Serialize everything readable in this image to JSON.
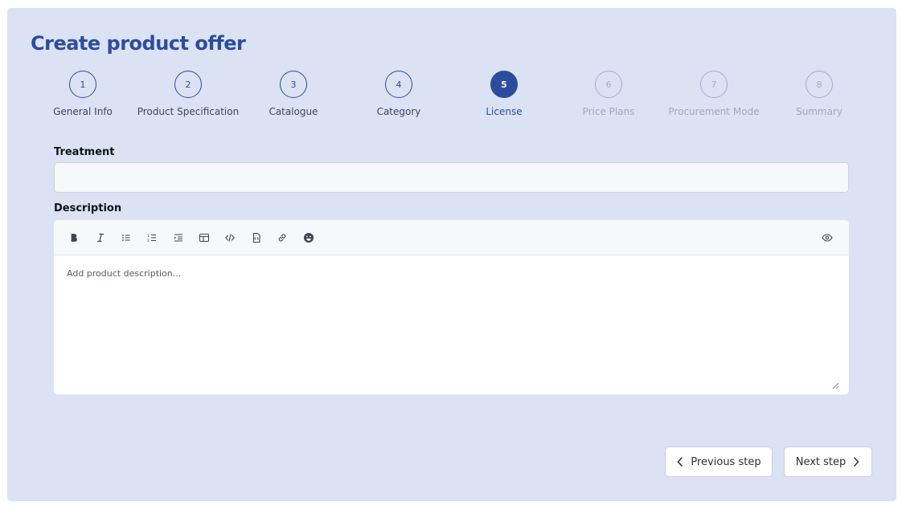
{
  "page": {
    "title": "Create product offer"
  },
  "stepper": {
    "current_step": 5,
    "steps": [
      {
        "number": "1",
        "label": "General Info",
        "state": "completed"
      },
      {
        "number": "2",
        "label": "Product Specification",
        "state": "completed"
      },
      {
        "number": "3",
        "label": "Catalogue",
        "state": "completed"
      },
      {
        "number": "4",
        "label": "Category",
        "state": "completed"
      },
      {
        "number": "5",
        "label": "License",
        "state": "active"
      },
      {
        "number": "6",
        "label": "Price Plans",
        "state": "upcoming"
      },
      {
        "number": "7",
        "label": "Procurement Mode",
        "state": "upcoming"
      },
      {
        "number": "8",
        "label": "Summary",
        "state": "upcoming"
      }
    ]
  },
  "form": {
    "treatment": {
      "label": "Treatment",
      "value": ""
    },
    "description": {
      "label": "Description",
      "placeholder": "Add product description...",
      "value": "",
      "toolbar_tools": [
        "bold-icon",
        "italic-icon",
        "bullet-list-icon",
        "numbered-list-icon",
        "indent-icon",
        "table-icon",
        "code-icon",
        "code-block-icon",
        "link-icon",
        "emoji-icon",
        "preview-eye-icon"
      ]
    }
  },
  "actions": {
    "previous_label": "Previous step",
    "next_label": "Next step"
  },
  "colors": {
    "panel_background": "#dae2f3",
    "accent": "#2c4d9e",
    "inactive_step": "#a2add0"
  }
}
